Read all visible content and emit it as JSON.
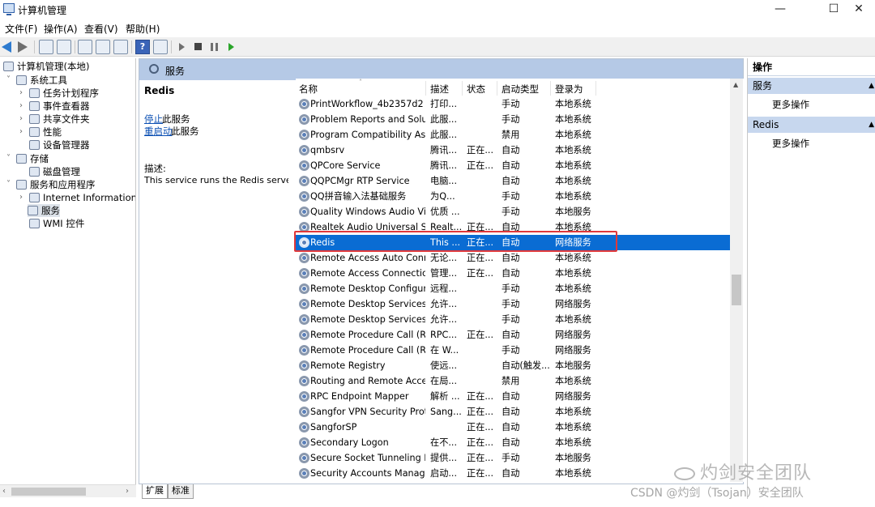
{
  "window": {
    "title": "计算机管理",
    "minimize": "—",
    "maximize": "☐",
    "close": "✕"
  },
  "menu": [
    "文件(F)",
    "操作(A)",
    "查看(V)",
    "帮助(H)"
  ],
  "tree": {
    "root": "计算机管理(本地)",
    "system_tools": "系统工具",
    "task_scheduler": "任务计划程序",
    "event_viewer": "事件查看器",
    "shared_folders": "共享文件夹",
    "performance": "性能",
    "device_manager": "设备管理器",
    "storage": "存储",
    "disk_management": "磁盘管理",
    "services_apps": "服务和应用程序",
    "iis": "Internet Information Se",
    "services": "服务",
    "wmi": "WMI 控件"
  },
  "center": {
    "header": "服务",
    "selected_service": "Redis",
    "stop_link": "停止",
    "stop_rest": "此服务",
    "restart_link": "重启动",
    "restart_rest": "此服务",
    "desc_label": "描述:",
    "desc_text": "This service runs the Redis server"
  },
  "columns": {
    "name": "名称",
    "desc": "描述",
    "status": "状态",
    "startup": "启动类型",
    "logon": "登录为"
  },
  "services": [
    {
      "name": "PrintWorkflow_4b2357d2",
      "desc": "打印...",
      "status": "",
      "startup": "手动",
      "logon": "本地系统"
    },
    {
      "name": "Problem Reports and Solut...",
      "desc": "此服...",
      "status": "",
      "startup": "手动",
      "logon": "本地系统"
    },
    {
      "name": "Program Compatibility Assi...",
      "desc": "此服...",
      "status": "",
      "startup": "禁用",
      "logon": "本地系统"
    },
    {
      "name": "qmbsrv",
      "desc": "腾讯...",
      "status": "正在...",
      "startup": "自动",
      "logon": "本地系统"
    },
    {
      "name": "QPCore Service",
      "desc": "腾讯...",
      "status": "正在...",
      "startup": "自动",
      "logon": "本地系统"
    },
    {
      "name": "QQPCMgr RTP Service",
      "desc": "电脑...",
      "status": "",
      "startup": "自动",
      "logon": "本地系统"
    },
    {
      "name": "QQ拼音输入法基础服务",
      "desc": "为Q...",
      "status": "",
      "startup": "手动",
      "logon": "本地系统"
    },
    {
      "name": "Quality Windows Audio Vi...",
      "desc": "优质 ...",
      "status": "",
      "startup": "手动",
      "logon": "本地服务"
    },
    {
      "name": "Realtek Audio Universal Se...",
      "desc": "Realt...",
      "status": "正在...",
      "startup": "自动",
      "logon": "本地系统"
    },
    {
      "name": "Redis",
      "desc": "This ...",
      "status": "正在...",
      "startup": "自动",
      "logon": "网络服务",
      "selected": true
    },
    {
      "name": "Remote Access Auto Conn...",
      "desc": "无论...",
      "status": "正在...",
      "startup": "自动",
      "logon": "本地系统"
    },
    {
      "name": "Remote Access Connectio...",
      "desc": "管理...",
      "status": "正在...",
      "startup": "自动",
      "logon": "本地系统"
    },
    {
      "name": "Remote Desktop Configur...",
      "desc": "远程...",
      "status": "",
      "startup": "手动",
      "logon": "本地系统"
    },
    {
      "name": "Remote Desktop Services",
      "desc": "允许...",
      "status": "",
      "startup": "手动",
      "logon": "网络服务"
    },
    {
      "name": "Remote Desktop Services ...",
      "desc": "允许...",
      "status": "",
      "startup": "手动",
      "logon": "本地系统"
    },
    {
      "name": "Remote Procedure Call (R...",
      "desc": "RPC...",
      "status": "正在...",
      "startup": "自动",
      "logon": "网络服务"
    },
    {
      "name": "Remote Procedure Call (R...",
      "desc": "在 W...",
      "status": "",
      "startup": "手动",
      "logon": "网络服务"
    },
    {
      "name": "Remote Registry",
      "desc": "使远...",
      "status": "",
      "startup": "自动(触发...",
      "logon": "本地服务"
    },
    {
      "name": "Routing and Remote Access",
      "desc": "在局...",
      "status": "",
      "startup": "禁用",
      "logon": "本地系统"
    },
    {
      "name": "RPC Endpoint Mapper",
      "desc": "解析 ...",
      "status": "正在...",
      "startup": "自动",
      "logon": "网络服务"
    },
    {
      "name": "Sangfor VPN Security Prot...",
      "desc": "Sang...",
      "status": "正在...",
      "startup": "自动",
      "logon": "本地系统"
    },
    {
      "name": "SangforSP",
      "desc": "",
      "status": "正在...",
      "startup": "自动",
      "logon": "本地系统"
    },
    {
      "name": "Secondary Logon",
      "desc": "在不...",
      "status": "正在...",
      "startup": "自动",
      "logon": "本地系统"
    },
    {
      "name": "Secure Socket Tunneling P...",
      "desc": "提供...",
      "status": "正在...",
      "startup": "手动",
      "logon": "本地服务"
    },
    {
      "name": "Security Accounts Manager",
      "desc": "启动...",
      "status": "正在...",
      "startup": "自动",
      "logon": "本地系统"
    }
  ],
  "tabs": {
    "extended": "扩展",
    "standard": "标准"
  },
  "actions": {
    "title": "操作",
    "group1": "服务",
    "group1_more": "更多操作",
    "group2": "Redis",
    "group2_more": "更多操作"
  },
  "watermark": {
    "main": "灼剑安全团队",
    "sub": "CSDN @灼剑（Tsojan）安全团队"
  },
  "colors": {
    "selection": "#0a6cd3",
    "highlight_box": "#e0383a",
    "header_band": "#b5c9e6"
  }
}
